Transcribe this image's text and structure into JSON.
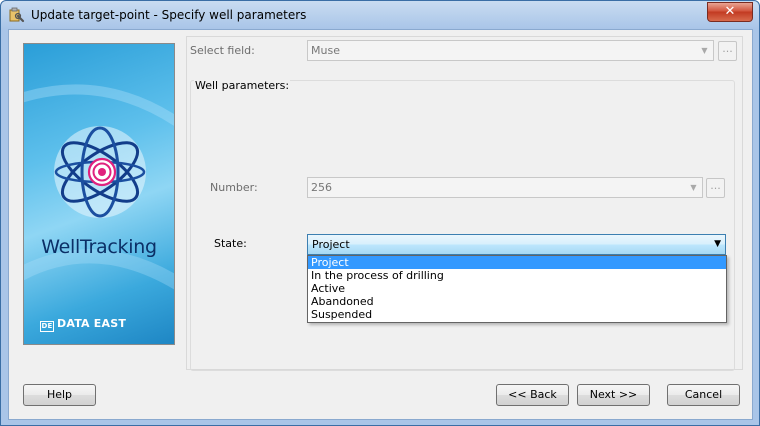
{
  "window": {
    "title": "Update target-point - Specify well parameters",
    "close_glyph": "✕"
  },
  "icons": {
    "app": "wrench-icon",
    "close": "close-icon"
  },
  "brand": {
    "product_name": "WellTracking",
    "company_name": "DATA EAST",
    "company_mark": "DE"
  },
  "form": {
    "select_field_label": "Select field:",
    "select_field_value": "Muse",
    "well_parameters_label": "Well parameters:",
    "number_label": "Number:",
    "number_value": "256",
    "state_label": "State:",
    "state_value": "Project",
    "ellipsis": "...",
    "state_options": [
      "Project",
      "In the process of drilling",
      "Active",
      "Abandoned",
      "Suspended"
    ],
    "selected_option_index": 0
  },
  "buttons": {
    "help": "Help",
    "back": "<< Back",
    "next": "Next >>",
    "cancel": "Cancel"
  },
  "colors": {
    "title_bar": "#a9c5e8",
    "selection": "#3399ff",
    "brand_text": "#0b2f66",
    "close_button": "#c23a22"
  }
}
